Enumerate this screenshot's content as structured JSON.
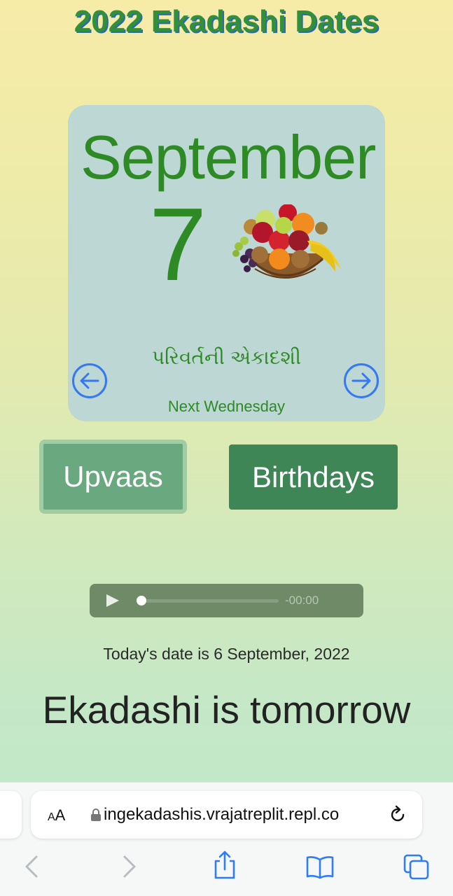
{
  "page": {
    "title": "2022 Ekadashi Dates"
  },
  "card": {
    "month": "September",
    "day": "7",
    "ekadashi_name": "પરિવર્તની એકાદશી",
    "next_day": "Next Wednesday",
    "image": "fruit-basket-icon"
  },
  "buttons": {
    "upvaas": "Upvaas",
    "birthdays": "Birthdays"
  },
  "audio": {
    "time_remaining": "-00:00",
    "progress": 0
  },
  "status": {
    "today": "Today's date is 6 September, 2022",
    "message": "Ekadashi is tomorrow"
  },
  "browser": {
    "text_size_label_small": "A",
    "text_size_label_large": "A",
    "url": "ingekadashis.vrajatreplit.repl.co",
    "toolbar_icons": [
      "back-icon",
      "forward-icon",
      "share-icon",
      "bookmarks-icon",
      "tabs-icon"
    ]
  },
  "colors": {
    "title_green": "#33903a",
    "title_shadow_blue": "#2c6aa8",
    "card_bg": "#bdd7d4",
    "date_green": "#2e8a25",
    "arrow_blue": "#3478f6",
    "upvaas_bg": "#6aa87f",
    "birthdays_bg": "#3f8656",
    "audio_bg": "#6f8a67"
  }
}
